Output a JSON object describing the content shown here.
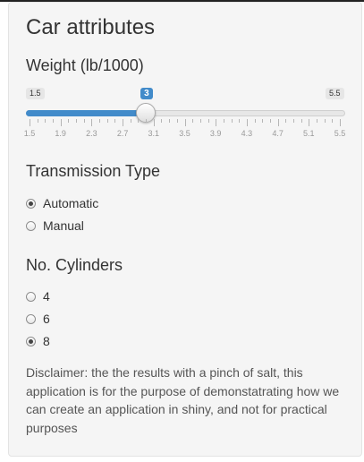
{
  "panel": {
    "title": "Car attributes"
  },
  "weight": {
    "label": "Weight (lb/1000)",
    "min": 1.5,
    "max": 5.5,
    "min_label": "1.5",
    "max_label": "5.5",
    "value": 3,
    "value_label": "3",
    "tick_labels": [
      "1.5",
      "1.9",
      "2.3",
      "2.7",
      "3.1",
      "3.5",
      "3.9",
      "4.3",
      "4.7",
      "5.1",
      "5.5"
    ],
    "accent_color": "#428bca"
  },
  "transmission": {
    "label": "Transmission Type",
    "options": [
      {
        "label": "Automatic",
        "checked": true
      },
      {
        "label": "Manual",
        "checked": false
      }
    ]
  },
  "cylinders": {
    "label": "No. Cylinders",
    "options": [
      {
        "label": "4",
        "checked": false
      },
      {
        "label": "6",
        "checked": false
      },
      {
        "label": "8",
        "checked": true
      }
    ]
  },
  "disclaimer": "Disclaimer: the the results with a pinch of salt, this application is for the purpose of demonstatrating how we can create an application in shiny, and not for practical purposes"
}
